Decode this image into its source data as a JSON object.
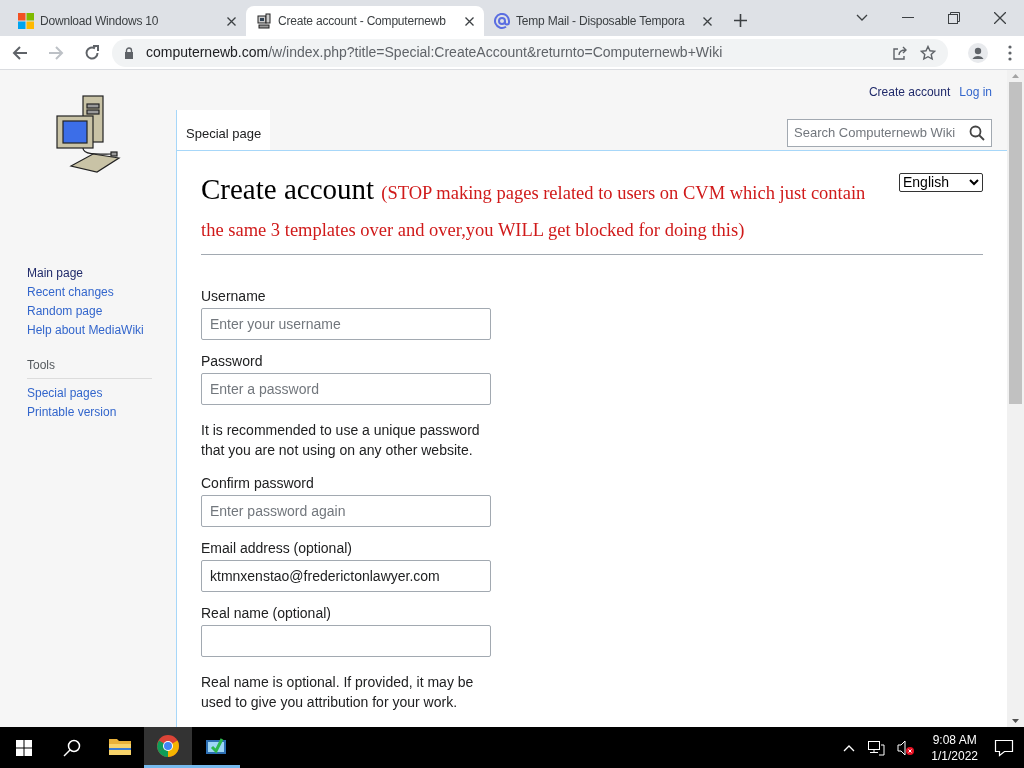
{
  "browser": {
    "tabs": [
      {
        "title": "Download Windows 10",
        "selected": false
      },
      {
        "title": "Create account - Computernewb",
        "selected": true
      },
      {
        "title": "Temp Mail - Disposable Tempora",
        "selected": false
      }
    ],
    "url_host": "computernewb.com",
    "url_path": "/w/index.php?title=Special:CreateAccount&returnto=Computernewb+Wiki"
  },
  "personal_links": [
    "Create account",
    "Log in"
  ],
  "sidebar": {
    "nav": [
      "Main page",
      "Recent changes",
      "Random page",
      "Help about MediaWiki"
    ],
    "tools_heading": "Tools",
    "tools": [
      "Special pages",
      "Printable version"
    ]
  },
  "page_tab": "Special page",
  "search": {
    "placeholder": "Search Computernewb Wiki"
  },
  "heading": "Create account",
  "notice": "(STOP making pages related to users on CVM which just contain the same 3 templates over and over,you WILL get blocked for doing this)",
  "language": "English",
  "form": [
    {
      "kind": "field",
      "label": "Username",
      "placeholder": "Enter your username"
    },
    {
      "kind": "field",
      "label": "Password",
      "placeholder": "Enter a password"
    },
    {
      "kind": "help",
      "text": "It is recommended to use a unique password that you are not using on any other website."
    },
    {
      "kind": "field",
      "label": "Confirm password",
      "placeholder": "Enter password again"
    },
    {
      "kind": "field",
      "label": "Email address (optional)",
      "value": "ktmnxenstao@frederictonlawyer.com"
    },
    {
      "kind": "field",
      "label": "Real name (optional)"
    },
    {
      "kind": "help",
      "text": "Real name is optional. If provided, it may be used to give you attribution for your work."
    }
  ],
  "taskbar": {
    "apps": [
      {
        "selected": false,
        "running": false
      },
      {
        "selected": true,
        "running": true
      },
      {
        "selected": false,
        "running": true
      }
    ],
    "time": "9:08 AM",
    "date": "1/1/2022"
  }
}
